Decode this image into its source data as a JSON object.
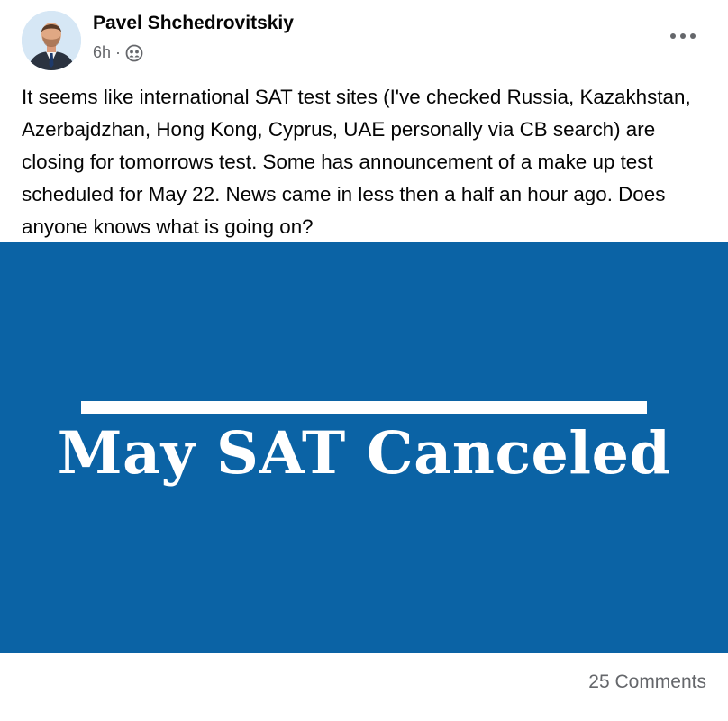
{
  "post": {
    "author": "Pavel Shchedrovitskiy",
    "time": "6h",
    "separator": "·",
    "audience_icon": "group-icon",
    "more_icon": "more-horizontal-icon",
    "text": "It seems like international SAT test sites (I've checked Russia, Kazakhstan, Azerbajdzhan, Hong Kong, Cyprus, UAE personally via CB search) are closing for tomorrows test. Some has announcement of a make up test scheduled for May 22. News came in less then a half an hour ago. Does anyone knows what is going on?",
    "image": {
      "headline": "May SAT Canceled",
      "background_color": "#0b63a5"
    },
    "comments": "25 Comments"
  }
}
